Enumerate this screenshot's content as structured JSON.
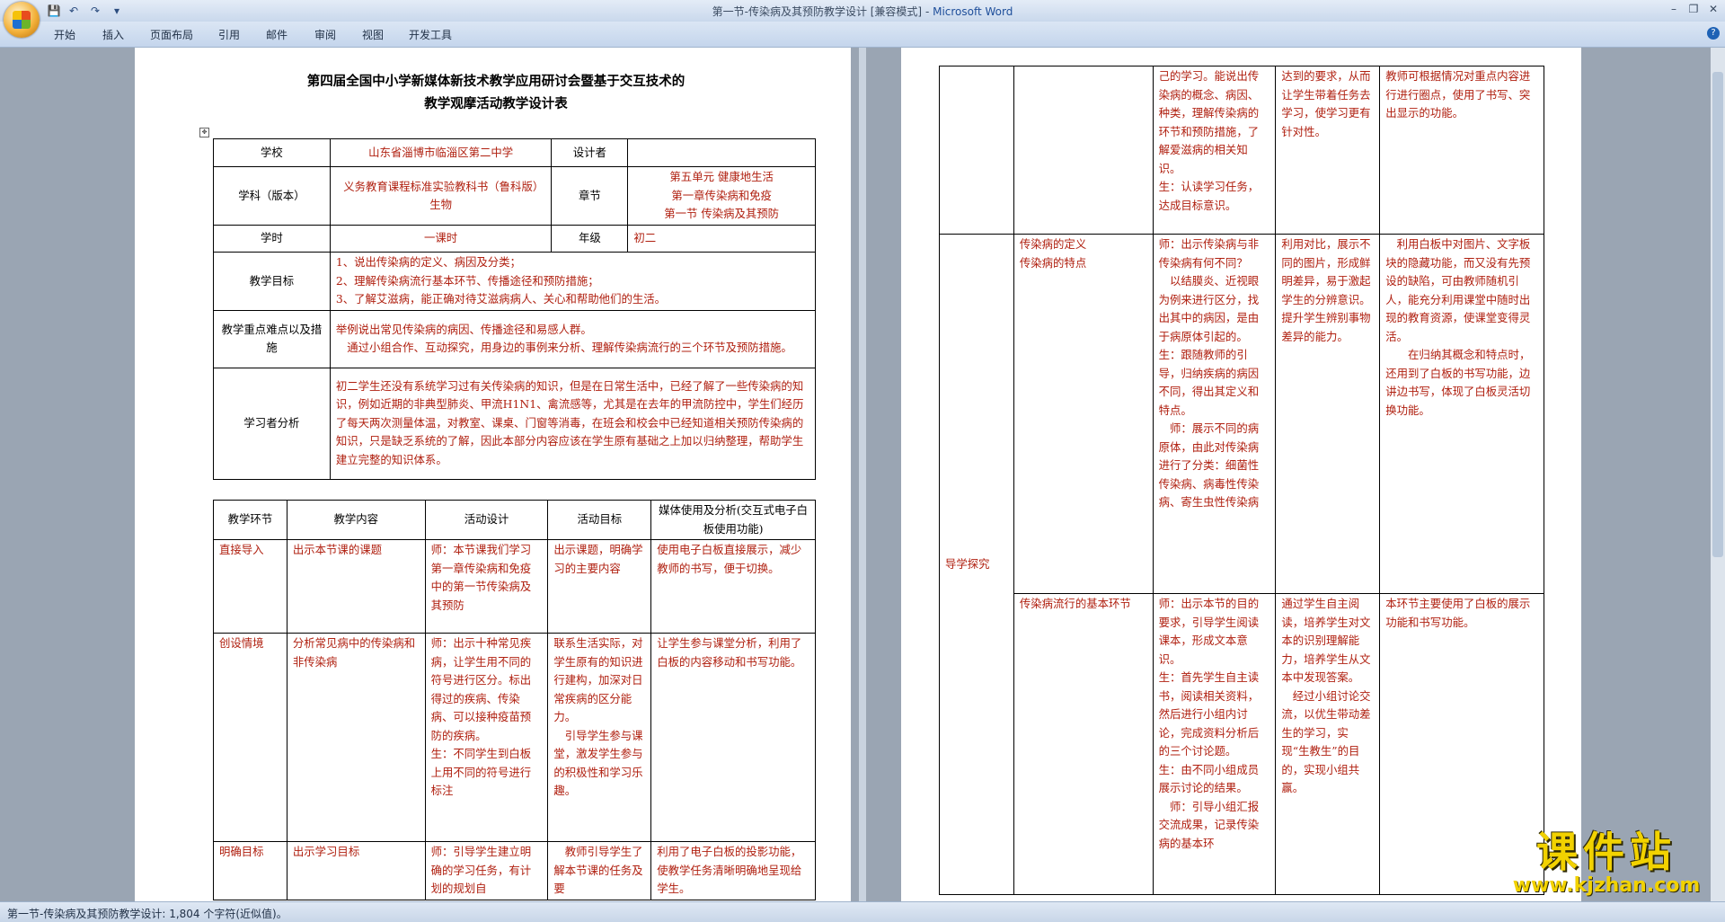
{
  "window": {
    "title": "第一节-传染病及其预防教学设计 [兼容模式]",
    "app": "Microsoft Word",
    "sep": " - "
  },
  "ribbon": {
    "tabs": [
      "开始",
      "插入",
      "页面布局",
      "引用",
      "邮件",
      "审阅",
      "视图",
      "开发工具"
    ]
  },
  "doc": {
    "title_line1": "第四届全国中小学新媒体新技术教学应用研讨会暨基于交互技术的",
    "title_line2": "教学观摩活动教学设计表",
    "info": {
      "school_label": "学校",
      "school": "山东省淄博市临淄区第二中学",
      "designer_label": "设计者",
      "designer": "",
      "subject_label": "学科（版本）",
      "subject": "义务教育课程标准实验教科书（鲁科版）　　生物",
      "chapter_label": "章节",
      "chapter_1": "第五单元  健康地生活",
      "chapter_2": "第一章传染病和免疫",
      "chapter_3": "第一节  传染病及其预防",
      "hours_label": "学时",
      "hours": "一课时",
      "grade_label": "年级",
      "grade": "初二",
      "goals_label": "教学目标",
      "goal_1": "1、说出传染病的定义、病因及分类；",
      "goal_2": "2、理解传染病流行基本环节、传播途径和预防措施；",
      "goal_3": "3、了解艾滋病，能正确对待艾滋病病人、关心和帮助他们的生活。",
      "keys_label": "教学重点难点以及措施",
      "keys_1": "举例说出常见传染病的病因、传播途径和易感人群。",
      "keys_2": "通过小组合作、互动探究，用身边的事例来分析、理解传染病流行的三个环节及预防措施。",
      "learner_label": "学习者分析",
      "learner": "初二学生还没有系统学习过有关传染病的知识，但是在日常生活中，已经了解了一些传染病的知识，例如近期的非典型肺炎、甲流H1N1、禽流感等，尤其是在去年的甲流防控中，学生们经历了每天两次测量体温，对教室、课桌、门窗等消毒，在班会和校会中已经知道相关预防传染病的知识，只是缺乏系统的了解，因此本部分内容应该在学生原有基础之上加以归纳整理，帮助学生建立完整的知识体系。"
    },
    "process_headers": [
      "教学环节",
      "教学内容",
      "活动设计",
      "活动目标",
      "媒体使用及分析(交互式电子白板使用功能)"
    ],
    "rows": [
      {
        "stage": "直接导入",
        "content": "出示本节课的课题",
        "activity": "师：本节课我们学习第一章传染病和免疫中的第一节传染病及其预防",
        "goal": "出示课题，明确学习的主要内容",
        "media": "使用电子白板直接展示，减少教师的书写，便于切换。"
      },
      {
        "stage": "创设情境",
        "content": "分析常见病中的传染病和非传染病",
        "activity_1": "师：出示十种常见疾病，让学生用不同的符号进行区分。标出得过的疾病、传染病、可以接种疫苗预防的疾病。",
        "activity_2": "生：不同学生到白板上用不同的符号进行标注",
        "goal_1": "联系生活实际，对学生原有的知识进行建构，加深对日常疾病的区分能力。",
        "goal_2": "引导学生参与课堂，激发学生参与的积极性和学习乐趣。",
        "media": "让学生参与课堂分析，利用了白板的内容移动和书写功能。"
      },
      {
        "stage": "明确目标",
        "content": "出示学习目标",
        "activity": "师：引导学生建立明确的学习任务，有计划的规划自",
        "goal": "教师引导学生了解本节课的任务及要",
        "media": "利用了电子白板的投影功能，使教学任务清晰明确地呈现给学生。"
      }
    ],
    "page2": {
      "top": {
        "activity": "己的学习。能说出传染病的概念、病因、种类，理解传染病的环节和预防措施，了解爱滋病的相关知识。",
        "activity_2": "生：认读学习任务，达成目标意识。",
        "goal": "达到的要求，从而让学生带着任务去学习，使学习更有针对性。",
        "media": "教师可根据情况对重点内容进行进行圈点，使用了书写、突出显示的功能。"
      },
      "stage": "导学探究",
      "r1": {
        "content_1": "传染病的定义",
        "content_2": "传染病的特点",
        "act_1": "师：出示传染病与非传染病有何不同？",
        "act_2": "以结膜炎、近视眼为例来进行区分，找出其中的病因，是由于病原体引起的。",
        "act_3": "生：跟随教师的引导，归纳疾病的病因不同，得出其定义和特点。",
        "act_4": "师：展示不同的病原体，由此对传染病进行了分类：细菌性传染病、病毒性传染病、寄生虫性传染病",
        "goal": "利用对比，展示不同的图片，形成鲜明差异，易于激起学生的分辨意识。提升学生辨别事物差异的能力。",
        "media_1": "利用白板中对图片、文字板块的隐藏功能，而又没有先预设的缺陷，可由教师随机引人，能充分利用课堂中随时出现的教育资源，使课堂变得灵活。",
        "media_2": "在归纳其概念和特点时，还用到了白板的书写功能，边讲边书写，体现了白板灵活切换功能。"
      },
      "r2": {
        "content": "传染病流行的基本环节",
        "act_1": "师：出示本节的目的要求，引导学生阅读课本，形成文本意识。",
        "act_2": "生：首先学生自主读书，阅读相关资料，然后进行小组内讨论，完成资料分析后的三个讨论题。",
        "act_3": "生：由不同小组成员展示讨论的结果。",
        "act_4": "师：引导小组汇报交流成果，记录传染病的基本环",
        "goal_1": "通过学生自主阅读，培养学生对文本的识别理解能力，培养学生从文本中发现答案。",
        "goal_2": "经过小组讨论交流，以优生带动差生的学习，实现“生教生”的目的，实现小组共赢。",
        "media": "本环节主要使用了白板的展示功能和书写功能。"
      }
    }
  },
  "status": {
    "text": "第一节-传染病及其预防教学设计: 1,804 个字符(近似值)。"
  },
  "watermark": {
    "main": "课件站",
    "url": "www.kjzhan.com"
  }
}
